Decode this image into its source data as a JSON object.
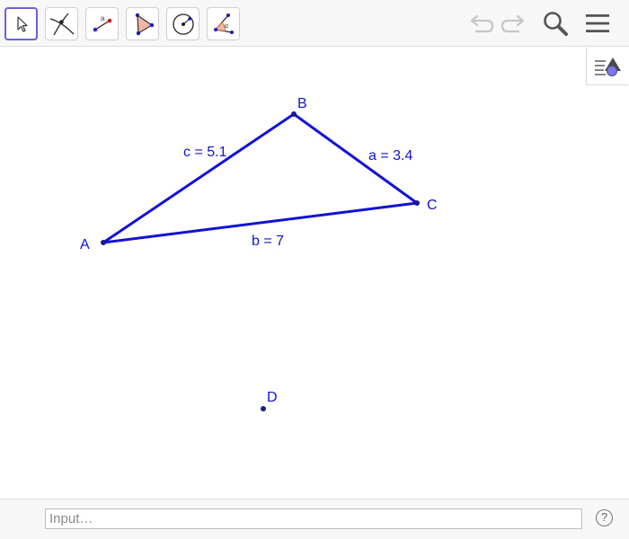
{
  "toolbar": {
    "tools": [
      {
        "name": "move-tool",
        "icon": "cursor-arrow-icon",
        "selected": true
      },
      {
        "name": "point-tool",
        "icon": "intersecting-lines-point-icon",
        "selected": false
      },
      {
        "name": "segment-tool",
        "icon": "segment-with-length-icon",
        "selected": false
      },
      {
        "name": "polygon-tool",
        "icon": "triangle-polygon-icon",
        "selected": false
      },
      {
        "name": "circle-tool",
        "icon": "circle-center-point-icon",
        "selected": false
      },
      {
        "name": "angle-tool",
        "icon": "angle-alpha-icon",
        "selected": false
      }
    ],
    "right_icons": [
      "undo-icon",
      "redo-icon",
      "search-icon",
      "menu-icon"
    ],
    "accent_color": "#6b62d8"
  },
  "style_bar_icon": "graphics-style-toggle-icon",
  "canvas": {
    "object_color": "#1212d6",
    "points": [
      {
        "id": "A",
        "label": "A"
      },
      {
        "id": "B",
        "label": "B"
      },
      {
        "id": "C",
        "label": "C"
      },
      {
        "id": "D",
        "label": "D"
      }
    ],
    "segments": [
      {
        "id": "c",
        "from": "A",
        "to": "B",
        "label": "c = 5.1"
      },
      {
        "id": "a",
        "from": "B",
        "to": "C",
        "label": "a = 3.4"
      },
      {
        "id": "b",
        "from": "A",
        "to": "C",
        "label": "b = 7"
      }
    ]
  },
  "input_bar": {
    "placeholder": "Input…",
    "help_label": "?"
  }
}
